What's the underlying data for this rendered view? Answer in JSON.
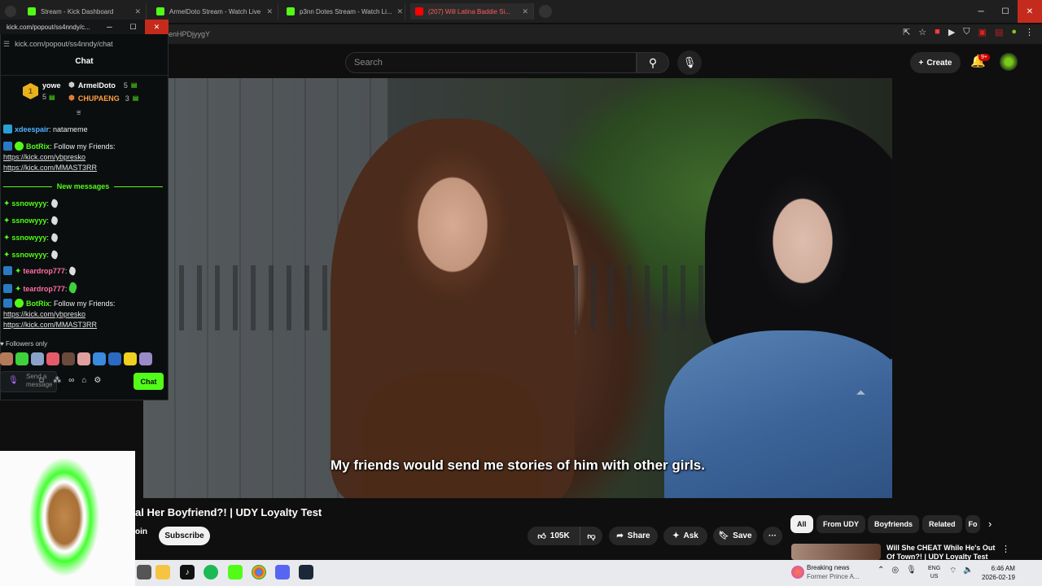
{
  "browser": {
    "tabs": [
      {
        "label": "Stream - Kick Dashboard",
        "active": false
      },
      {
        "label": "ArmelDoto Stream - Watch Live",
        "active": false
      },
      {
        "label": "p3nn Dotes Stream - Watch Li...",
        "active": false
      },
      {
        "label": "(207) Will Latina Baddie Si...",
        "active": true
      }
    ],
    "url_fragment": "enHPDjyygY"
  },
  "kick": {
    "window_title": "kick.com/popout/ss4nndy/c...",
    "url": "kick.com/popout/ss4nndy/chat",
    "chat_title": "Chat",
    "leaderboard": [
      {
        "rank": "1",
        "name": "yowe",
        "count": "5"
      },
      {
        "name": "ArmelDoto",
        "count": "5"
      },
      {
        "name": "CHUPAENG",
        "count": "3"
      }
    ],
    "messages_top": [
      {
        "user": "xdeespair",
        "text": "natameme"
      },
      {
        "user": "BotRix",
        "text": "Follow my Friends:",
        "links": [
          "https://kick.com/ybpresko",
          "https://kick.com/MMAST3RR"
        ]
      }
    ],
    "new_messages_label": "New messages",
    "messages_new": [
      {
        "user": "ssnowyyy"
      },
      {
        "user": "ssnowyyy"
      },
      {
        "user": "ssnowyyy"
      },
      {
        "user": "ssnowyyy"
      },
      {
        "user": "teardrop777"
      },
      {
        "user": "teardrop777"
      },
      {
        "user": "BotRix",
        "text": "Follow my Friends:",
        "links": [
          "https://kick.com/ybpresko",
          "https://kick.com/MMAST3RR"
        ]
      }
    ],
    "followers_only": "Followers only",
    "input_placeholder": "Send a message",
    "send_label": "Chat",
    "colors": {
      "accent": "#53fc18",
      "leader_gold": "#e9b21c",
      "chupaeng": "#ff9f40",
      "teardrop": "#ff6fa3"
    }
  },
  "youtube": {
    "search_placeholder": "Search",
    "create_label": "Create",
    "notifications_badge": "9+",
    "caption": "My friends would send me stories of him with other girls.",
    "video_title": "al Her Boyfriend?! | UDY Loyalty Test",
    "join_label": "oin",
    "subscribe_label": "Subscribe",
    "like_count": "105K",
    "share_label": "Share",
    "ask_label": "Ask",
    "save_label": "Save",
    "chips": [
      "All",
      "From UDY",
      "Boyfriends",
      "Related",
      "Fo"
    ],
    "recommended": {
      "title": "Will She CHEAT While He's Out Of Town?! | UDY Loyalty Test"
    }
  },
  "taskbar": {
    "news_title": "Breaking news",
    "news_sub": "Former Prince A...",
    "lang_line1": "ENG",
    "lang_line2": "US",
    "time": "6:46 AM",
    "date": "2026-02-19"
  }
}
